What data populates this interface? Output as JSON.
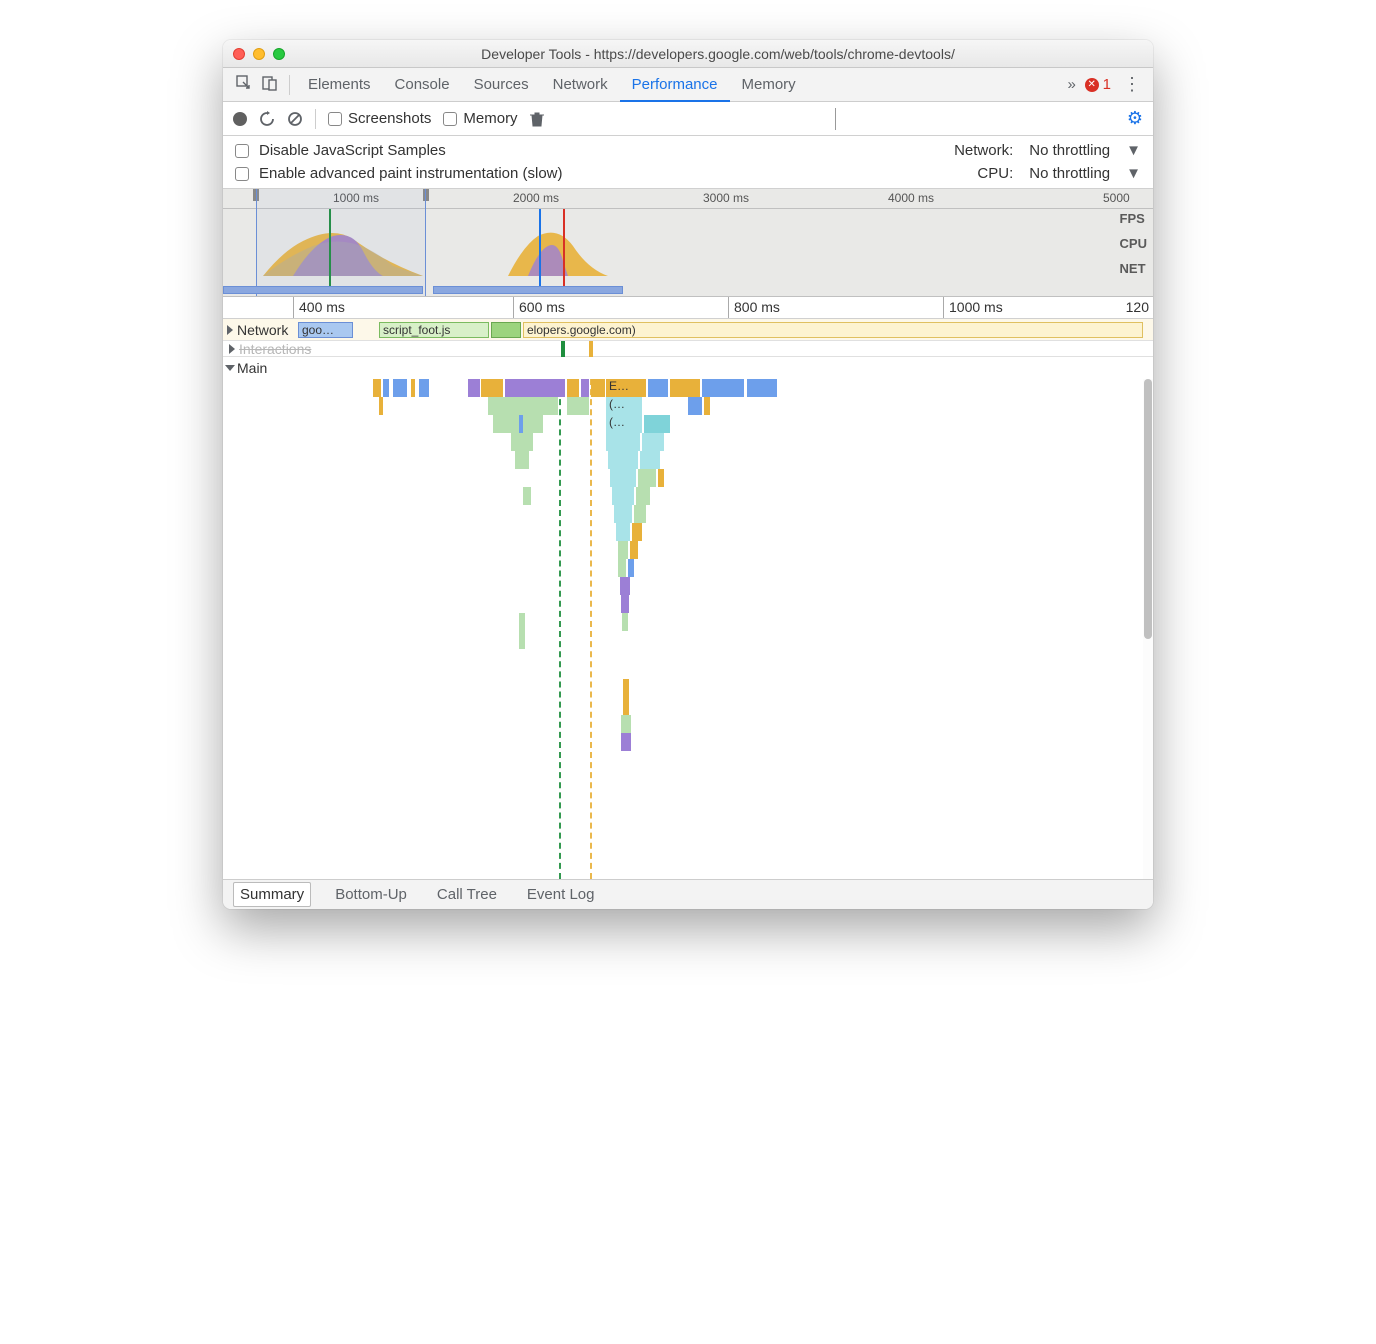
{
  "window": {
    "title": "Developer Tools - https://developers.google.com/web/tools/chrome-devtools/"
  },
  "mainTabs": {
    "items": [
      "Elements",
      "Console",
      "Sources",
      "Network",
      "Performance",
      "Memory"
    ],
    "active": "Performance",
    "overflow_glyph": "»",
    "error_count": "1",
    "more_glyph": "⋮"
  },
  "toolbar1": {
    "screenshots_label": "Screenshots",
    "memory_label": "Memory"
  },
  "settings": {
    "disable_js_label": "Disable JavaScript Samples",
    "enable_paint_label": "Enable advanced paint instrumentation (slow)",
    "network_label": "Network:",
    "network_value": "No throttling",
    "cpu_label": "CPU:",
    "cpu_value": "No throttling"
  },
  "overview": {
    "ticks": [
      "1000 ms",
      "2000 ms",
      "3000 ms",
      "4000 ms",
      "5000"
    ],
    "lane_labels": [
      "FPS",
      "CPU",
      "NET"
    ]
  },
  "detail_ruler": {
    "ticks": [
      "400 ms",
      "600 ms",
      "800 ms",
      "1000 ms",
      "120"
    ]
  },
  "lanes": {
    "network_label": "Network",
    "network_item1": "goo…",
    "network_item2": "script_foot.js",
    "network_item3": "elopers.google.com)",
    "interactions_label": "Interactions",
    "main_label": "Main",
    "flame_labels": {
      "e": "E…",
      "anon1": "(…",
      "anon2": "(…"
    }
  },
  "bottomTabs": {
    "items": [
      "Summary",
      "Bottom-Up",
      "Call Tree",
      "Event Log"
    ],
    "active": "Summary"
  }
}
